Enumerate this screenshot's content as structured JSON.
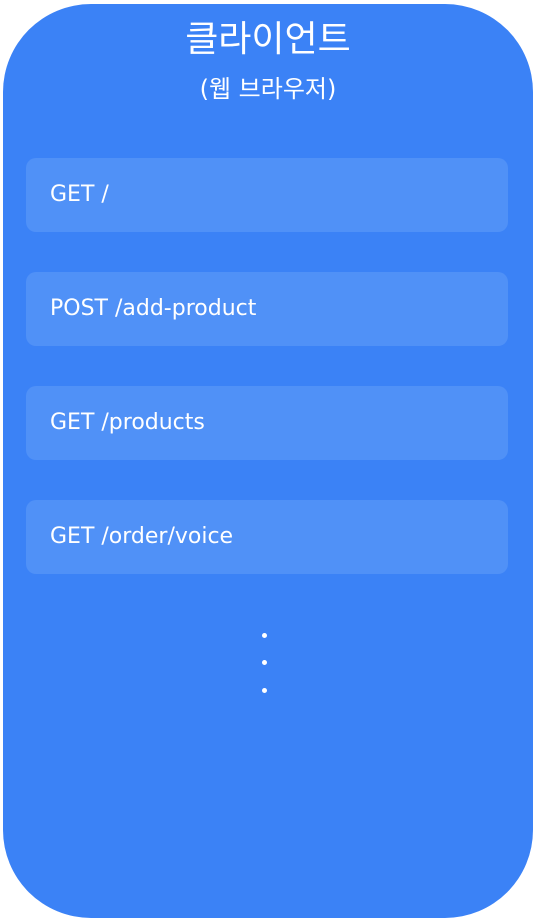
{
  "client": {
    "title": "클라이언트",
    "subtitle": "(웹 브라우저)",
    "routes": [
      {
        "label": "GET /"
      },
      {
        "label": "POST /add-product"
      },
      {
        "label": "GET /products"
      },
      {
        "label": "GET /order/voice"
      }
    ],
    "ellipsis": "vertical-ellipsis"
  },
  "colors": {
    "panel": "#3b82f6",
    "route_box": "#5091f7",
    "text": "#ffffff"
  }
}
